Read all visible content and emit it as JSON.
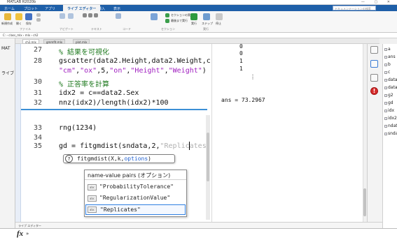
{
  "app": {
    "title": "MATLAB R2020b"
  },
  "ribbon_tabs": [
    "ホーム",
    "プロット",
    "アプリ",
    "ライブ エディター",
    "挿入",
    "表示"
  ],
  "search_placeholder": "ドキュメンテーションの検索",
  "sections": [
    "ファイル",
    "ナビゲート",
    "テキスト",
    "コード",
    "セクション",
    "実行"
  ],
  "ribbon_buttons": {
    "new": "新規作成",
    "open": "開く",
    "save": "保存",
    "run_section": "セクションの実行",
    "run_to_end": "最後まで実行",
    "run": "実行",
    "step": "ステップ",
    "stop": "停止"
  },
  "address": "C: › class_mlx › mlx › ch2",
  "left_panel": {
    "items": [
      "MAT",
      "ライブ"
    ]
  },
  "editor_tabs": [
    "ch2.mlx",
    "gmmfit.mlx",
    "plot.mlx"
  ],
  "code": {
    "lines": [
      {
        "num": "27",
        "parts": [
          {
            "t": "% 結果を可視化",
            "c": "cmt"
          }
        ]
      },
      {
        "num": "28",
        "parts": [
          {
            "t": "gscatter(data2.Height,data2.Weight,c,",
            "c": ""
          }
        ]
      },
      {
        "num": "",
        "parts": [
          {
            "t": "\"cm\"",
            "c": "str"
          },
          {
            "t": ",",
            "c": ""
          },
          {
            "t": "\"ox\"",
            "c": "str"
          },
          {
            "t": ",5,",
            "c": ""
          },
          {
            "t": "\"on\"",
            "c": "str"
          },
          {
            "t": ",",
            "c": ""
          },
          {
            "t": "\"Height\"",
            "c": "str"
          },
          {
            "t": ",",
            "c": ""
          },
          {
            "t": "\"Weight\"",
            "c": "str"
          },
          {
            "t": ")",
            "c": ""
          }
        ]
      },
      {
        "num": "30",
        "parts": [
          {
            "t": "% 正答率を計算",
            "c": "cmt"
          }
        ]
      },
      {
        "num": "31",
        "parts": [
          {
            "t": "idx2 = c==data2.Sex",
            "c": ""
          }
        ]
      },
      {
        "num": "32",
        "parts": [
          {
            "t": "nnz(idx2)/length(idx2)*100",
            "c": ""
          }
        ]
      },
      {
        "num": "33",
        "parts": [
          {
            "t": "rng(1234)",
            "c": ""
          }
        ]
      },
      {
        "num": "34",
        "parts": [
          {
            "t": "",
            "c": ""
          }
        ]
      },
      {
        "num": "35",
        "parts": [
          {
            "t": "gd = fitgmdist(sndata,2,",
            "c": ""
          },
          {
            "t": "\"Replicates\"",
            "c": "str"
          },
          {
            "t": ")",
            "c": ""
          }
        ]
      }
    ]
  },
  "output": {
    "column": [
      "0",
      "0",
      "1",
      "1"
    ],
    "ellipsis": [
      "⋮"
    ],
    "ans": "ans = 73.2967"
  },
  "hint": {
    "prefix": "fitgmdist(X,k,",
    "param": "options",
    "suffix": ")"
  },
  "popup": {
    "header": "name-value pairs (オプション)",
    "items": [
      "\"ProbabilityTolerance\"",
      "\"RegularizationValue\"",
      "\"Replicates\""
    ],
    "selected_index": 2
  },
  "workspace": {
    "items": [
      "a",
      "ans",
      "b",
      "c",
      "data",
      "data",
      "g2",
      "gd",
      "idx",
      "idx2",
      "ndat",
      "snda"
    ]
  },
  "status": {
    "text": "ライブ エディター"
  },
  "command": {
    "fx": "fx",
    "chevron": "»"
  }
}
